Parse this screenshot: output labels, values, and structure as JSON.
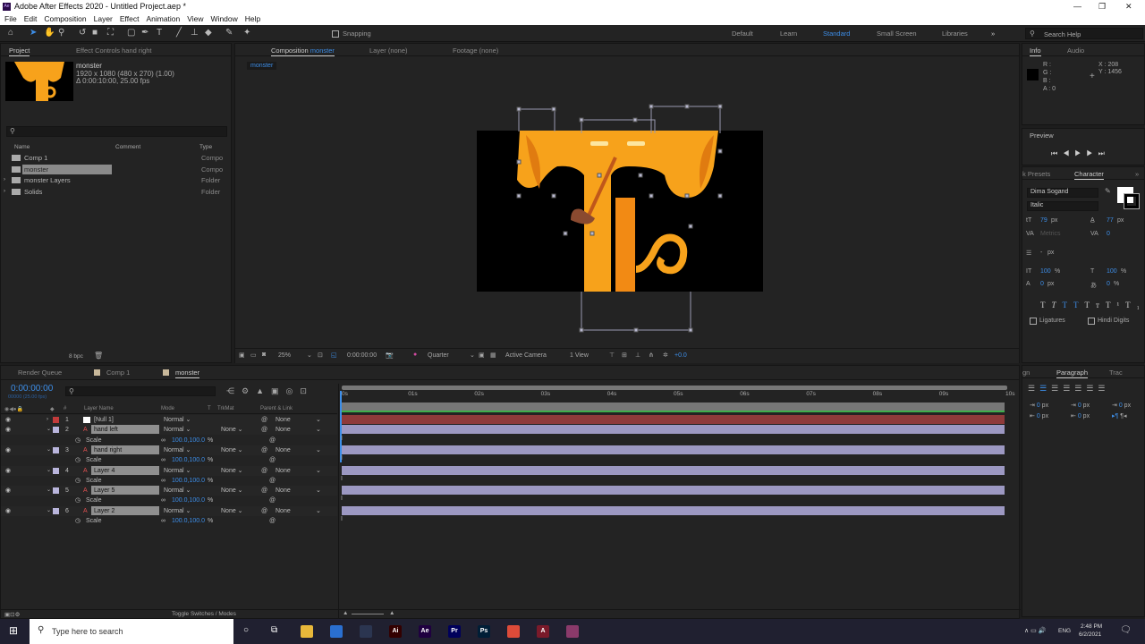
{
  "app": {
    "title": "Adobe After Effects 2020 - Untitled Project.aep *",
    "logo": "Ae"
  },
  "menu": [
    "File",
    "Edit",
    "Composition",
    "Layer",
    "Effect",
    "Animation",
    "View",
    "Window",
    "Help"
  ],
  "toolbar": {
    "snapping": "Snapping",
    "workspaces": [
      "Default",
      "Learn",
      "Standard",
      "Small Screen",
      "Libraries"
    ],
    "active_workspace": "Standard",
    "search_placeholder": "Search Help"
  },
  "project": {
    "tab": "Project",
    "effect_tab": "Effect Controls hand right",
    "comp_name": "monster",
    "resolution": "1920 x 1080  (480 x 270) (1.00)",
    "duration": "Δ 0:00:10:00, 25.00 fps",
    "columns": {
      "name": "Name",
      "comment": "Comment",
      "type": "Type"
    },
    "items": [
      {
        "name": "Comp 1",
        "type": "Compo",
        "icon": "composition-icon"
      },
      {
        "name": "monster",
        "type": "Compo",
        "icon": "composition-icon",
        "selected": true
      },
      {
        "name": "monster Layers",
        "type": "Folder",
        "icon": "folder-icon"
      },
      {
        "name": "Solids",
        "type": "Folder",
        "icon": "folder-icon"
      }
    ],
    "bpc": "8 bpc"
  },
  "composition": {
    "tab_prefix": "Composition",
    "tab_name": "monster",
    "layer_tab": "Layer (none)",
    "footage_tab": "Footage (none)",
    "breadcrumb": "monster",
    "zoom": "25%",
    "timecode": "0:00:00:00",
    "resolution": "Quarter",
    "camera": "Active Camera",
    "views": "1 View",
    "exposure": "+0.0"
  },
  "info": {
    "tab": "Info",
    "audio_tab": "Audio",
    "r": "R :",
    "g": "G :",
    "b": "B :",
    "a": "A :  0",
    "x": "X : 208",
    "y": "Y : 1456"
  },
  "preview": {
    "tab": "Preview"
  },
  "character": {
    "presets_tab": "k Presets",
    "tab": "Character",
    "font": "Dima Sogand",
    "style": "Italic",
    "size": "79",
    "size_unit": "px",
    "leading": "77",
    "leading_unit": "px",
    "kerning": "Metrics",
    "tracking": "0",
    "stroke": "-",
    "stroke_unit": "px",
    "vscale": "100",
    "hscale": "100",
    "pct": "%",
    "baseline": "0",
    "baseline_unit": "px",
    "tsume": "0",
    "tsume_unit": "%",
    "ligatures": "Ligatures",
    "hindi": "Hindi Digits",
    "fill_color": "#ffffff",
    "stroke_color": "#000000"
  },
  "paragraph": {
    "left_tab": "gn",
    "tab": "Paragraph",
    "right_tab": "Trac",
    "indents": [
      "0",
      "0",
      "0",
      "0",
      "0"
    ],
    "unit": "px"
  },
  "timeline": {
    "tabs": [
      "Render Queue",
      "Comp 1",
      "monster"
    ],
    "active_tab": "monster",
    "timecode": "0:00:00:00",
    "fps": "00000 (25.00 fps)",
    "columns": {
      "layer_name": "Layer Name",
      "mode": "Mode",
      "t": "T",
      "trkmat": "TrkMat",
      "parent": "Parent & Link",
      "num": "#"
    },
    "ruler": [
      "0s",
      "01s",
      "02s",
      "03s",
      "04s",
      "05s",
      "06s",
      "07s",
      "08s",
      "09s",
      "10s"
    ],
    "layers": [
      {
        "num": "1",
        "name": "[Null 1]",
        "mode": "Normal",
        "trkmat": "",
        "parent": "None",
        "label": "#c23b3b",
        "null": true,
        "bar": "#8e3a3a"
      },
      {
        "num": "2",
        "name": "hand left",
        "mode": "Normal",
        "trkmat": "None",
        "parent": "None",
        "label": "#b9b5dc",
        "scale": "100.0,100.0",
        "bar": "#9c98c2"
      },
      {
        "num": "3",
        "name": "hand right",
        "mode": "Normal",
        "trkmat": "None",
        "parent": "None",
        "label": "#b9b5dc",
        "scale": "100.0,100.0",
        "bar": "#9c98c2"
      },
      {
        "num": "4",
        "name": "Layer 4",
        "mode": "Normal",
        "trkmat": "None",
        "parent": "None",
        "label": "#b9b5dc",
        "scale": "100.0,100.0",
        "bar": "#9c98c2"
      },
      {
        "num": "5",
        "name": "Layer 5",
        "mode": "Normal",
        "trkmat": "None",
        "parent": "None",
        "label": "#b9b5dc",
        "scale": "100.0,100.0",
        "bar": "#9c98c2"
      },
      {
        "num": "6",
        "name": "Layer 2",
        "mode": "Normal",
        "trkmat": "None",
        "parent": "None",
        "label": "#b9b5dc",
        "scale": "100.0,100.0",
        "bar": "#9c98c2"
      }
    ],
    "scale_label": "Scale",
    "pct": "%",
    "toggle": "Toggle Switches / Modes"
  },
  "taskbar": {
    "search_placeholder": "Type here to search",
    "lang": "ENG",
    "time": "2:48 PM",
    "date": "6/2/2021",
    "apps": [
      {
        "n": "file-explorer",
        "t": "",
        "c": "#e8b83a"
      },
      {
        "n": "app-blue",
        "t": "",
        "c": "#2a6fd0"
      },
      {
        "n": "cinema4d",
        "t": "",
        "c": "#2b3550"
      },
      {
        "n": "illustrator",
        "t": "Ai",
        "c": "#330000"
      },
      {
        "n": "after-effects",
        "t": "Ae",
        "c": "#1f0040"
      },
      {
        "n": "premiere",
        "t": "Pr",
        "c": "#00005b"
      },
      {
        "n": "photoshop",
        "t": "Ps",
        "c": "#001e36"
      },
      {
        "n": "chrome",
        "t": "",
        "c": "#dd4b39"
      },
      {
        "n": "acrobat",
        "t": "A",
        "c": "#7a1a2a"
      },
      {
        "n": "winrar",
        "t": "",
        "c": "#8a3a6a"
      }
    ]
  },
  "colors": {
    "accent": "#3d8ee8",
    "panel": "#232323",
    "monster": "#f7a21b"
  }
}
